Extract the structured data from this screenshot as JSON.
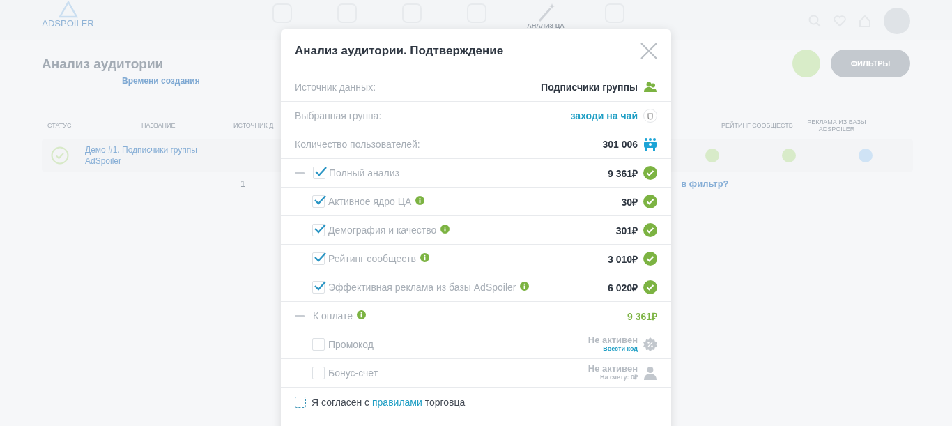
{
  "background": {
    "logo": "ADSPOILER",
    "nav_active": "АНАЛИЗ ЦА",
    "title": "Анализ аудитории",
    "sort": "Времени создания",
    "filters_button": "ФИЛЬТРЫ",
    "columns": [
      "СТАТУС",
      "НАЗВАНИЕ",
      "ИСТОЧНИК Д",
      "РЕЙТИНГ СООБЩЕСТВ",
      "РЕКЛАМА ИЗ БАЗЫ ADSPOILER"
    ],
    "row": {
      "name": "Демо #1. Подписчики группы AdSpoiler"
    },
    "page": "1",
    "filter_hint": "в фильтр?"
  },
  "modal": {
    "title": "Анализ аудитории. Подтверждение",
    "info_rows": [
      {
        "kind": "source",
        "label": "Источник данных:",
        "value": "Подписчики группы"
      },
      {
        "kind": "group",
        "label": "Выбранная группа:",
        "value": "заходи на чай"
      },
      {
        "kind": "count",
        "label": "Количество пользователей:",
        "value": "301 006"
      }
    ],
    "items": [
      {
        "label": "Полный анализ",
        "price": "9 361₽",
        "checked": true,
        "info": false,
        "children": [
          {
            "label": "Активное ядро ЦА",
            "price": "30₽",
            "checked": true,
            "info": true
          },
          {
            "label": "Демография и качество",
            "price": "301₽",
            "checked": true,
            "info": true
          },
          {
            "label": "Рейтинг сообществ",
            "price": "3 010₽",
            "checked": true,
            "info": true
          },
          {
            "label": "Эффективная реклама из базы AdSpoiler",
            "price": "6 020₽",
            "checked": true,
            "info": true
          }
        ]
      }
    ],
    "total": {
      "label": "К оплате",
      "amount": "9 361₽"
    },
    "options": [
      {
        "kind": "promo",
        "label": "Промокод",
        "checked": false,
        "status": "Не активен",
        "sub": "Ввести код"
      },
      {
        "kind": "bonus",
        "label": "Бонус-счет",
        "checked": false,
        "status": "Не активен",
        "sub": "На счету: 0₽"
      }
    ],
    "agreement": {
      "checked": false,
      "before": "Я согласен с",
      "link": "правилами",
      "after": "торговца"
    }
  }
}
